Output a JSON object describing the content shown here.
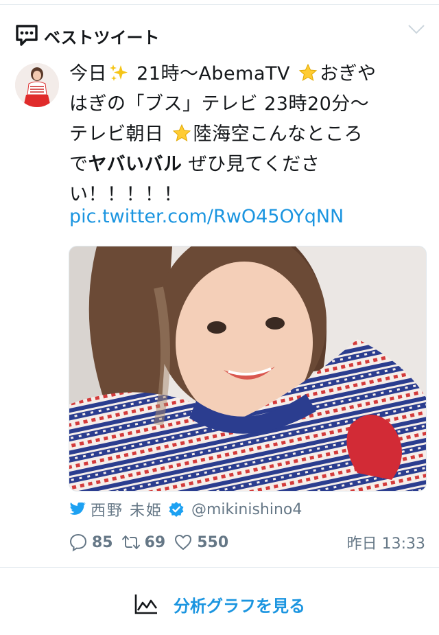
{
  "header": {
    "title": "ベストツイート",
    "icon": "speech-bubble-icon",
    "collapse_icon": "chevron-down-icon"
  },
  "tweet": {
    "lines": [
      {
        "before": "今日",
        "after": " 21時〜AbemaTV ",
        "tail": "おぎや"
      },
      {
        "text": "はぎの「ブス」テレビ 23時20分〜"
      },
      {
        "before": "テレビ朝日 ",
        "after": "陸海空こんなところ"
      },
      {
        "prefix": "で",
        "bold": "ヤバいバル",
        "rest": " ぜひ見てくださ"
      },
      {
        "text": "い！！！！！"
      }
    ],
    "link": "pic.twitter.com/RwO45OYqNN",
    "emoji": [
      "sparkles-icon",
      "star-icon",
      "star-icon"
    ]
  },
  "author": {
    "name": "西野 未姫",
    "handle": "@mikinishino4",
    "verified": true
  },
  "stats": {
    "replies": "85",
    "retweets": "69",
    "likes": "550",
    "timestamp": "昨日 13:33"
  },
  "footer": {
    "analytics_label": "分析グラフを見る"
  },
  "colors": {
    "accent": "#1b95e0",
    "secondary_text": "#657786",
    "divider": "#e6ecf0"
  }
}
